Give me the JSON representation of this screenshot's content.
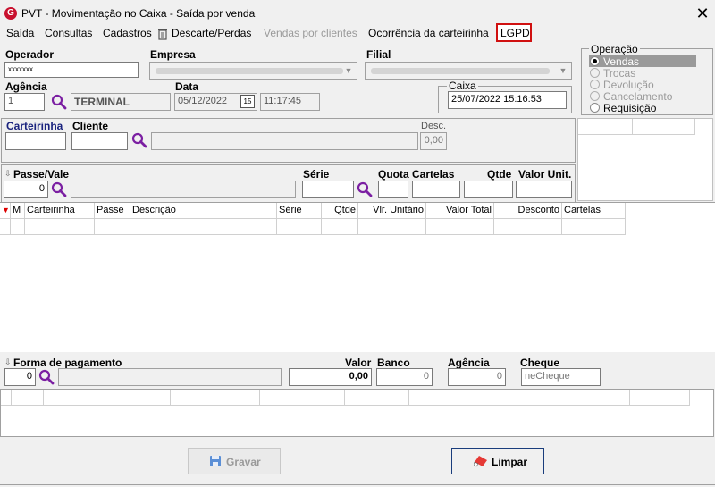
{
  "window": {
    "title": "PVT - Movimentação no Caixa - Saída por venda",
    "close_glyph": "✕"
  },
  "menu": {
    "items": [
      "Saída",
      "Consultas",
      "Cadastros",
      "Descarte/Perdas",
      "Vendas por clientes",
      "Ocorrência da carteirinha",
      "LGPD"
    ]
  },
  "operador": {
    "label": "Operador",
    "value": "xxxxxxx"
  },
  "empresa": {
    "label": "Empresa"
  },
  "filial": {
    "label": "Filial"
  },
  "agencia": {
    "label": "Agência",
    "value": "1",
    "name": "TERMINAL"
  },
  "data": {
    "label": "Data",
    "date": "05/12/2022",
    "time": "11:17:45",
    "calendar_glyph": "15"
  },
  "caixa": {
    "label": "Caixa",
    "value": "25/07/2022 15:16:53"
  },
  "operacao": {
    "label": "Operação",
    "options": [
      "Vendas",
      "Trocas",
      "Devolução",
      "Cancelamento",
      "Requisição"
    ],
    "selected": "Vendas"
  },
  "cliente_row": {
    "carteirinha_label": "Carteirinha",
    "cliente_label": "Cliente",
    "desc_label": "Desc.",
    "desc_value": "0,00"
  },
  "passe_row": {
    "passe_label": "Passe/Vale",
    "passe_value": "0",
    "serie_label": "Série",
    "quota_label": "Quota",
    "cartelas_label": "Cartelas",
    "qtde_label": "Qtde",
    "valor_unit_label": "Valor Unit."
  },
  "items_grid": {
    "columns": [
      "M",
      "Carteirinha",
      "Passe",
      "Descrição",
      "Série",
      "Qtde",
      "Vlr. Unitário",
      "Valor Total",
      "Desconto",
      "Cartelas"
    ]
  },
  "pagamento": {
    "forma_label": "Forma de pagamento",
    "forma_value": "0",
    "valor_label": "Valor",
    "valor_value": "0,00",
    "banco_label": "Banco",
    "banco_value": "0",
    "agencia_label": "Agência",
    "agencia_value": "0",
    "cheque_label": "Cheque",
    "cheque_value": "neCheque"
  },
  "buttons": {
    "gravar": "Gravar",
    "limpar": "Limpar"
  },
  "colors": {
    "accent_red": "#c8102e",
    "search_purple": "#7b1fa2",
    "label_blue": "#1a237e"
  }
}
